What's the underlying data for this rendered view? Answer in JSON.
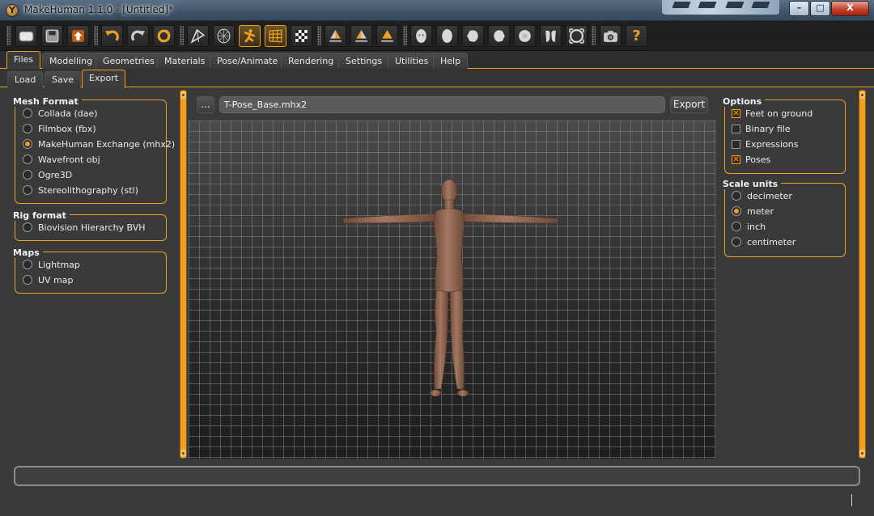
{
  "window": {
    "title": "MakeHuman 1.1.0 - [Untitled]*",
    "controls": {
      "minimize": "–",
      "maximize": "□",
      "close": "X"
    }
  },
  "toolbar": {
    "tools": [
      "undo-icon",
      "redo-icon",
      "reset-icon",
      "smooth-icon",
      "wireframe-icon",
      "pose-icon",
      "grid-icon",
      "checker-icon",
      "symmetry-right-icon",
      "symmetry-left-icon",
      "symmetry-icon",
      "front-view-icon",
      "back-view-icon",
      "left-view-icon",
      "right-view-icon",
      "top-view-icon",
      "bottom-view-icon",
      "reset-camera-icon",
      "screenshot-icon",
      "help-icon"
    ],
    "help_label": "?"
  },
  "tabs": [
    {
      "label": "Files",
      "active": true
    },
    {
      "label": "Modelling"
    },
    {
      "label": "Geometries"
    },
    {
      "label": "Materials"
    },
    {
      "label": "Pose/Animate"
    },
    {
      "label": "Rendering"
    },
    {
      "label": "Settings"
    },
    {
      "label": "Utilities"
    },
    {
      "label": "Help"
    }
  ],
  "subtabs": [
    {
      "label": "Load"
    },
    {
      "label": "Save"
    },
    {
      "label": "Export",
      "active": true
    }
  ],
  "left": {
    "mesh_format": {
      "title": "Mesh Format",
      "options": [
        {
          "label": "Collada (dae)",
          "selected": false
        },
        {
          "label": "Filmbox (fbx)",
          "selected": false
        },
        {
          "label": "MakeHuman Exchange (mhx2)",
          "selected": true
        },
        {
          "label": "Wavefront obj",
          "selected": false
        },
        {
          "label": "Ogre3D",
          "selected": false
        },
        {
          "label": "Stereolithography (stl)",
          "selected": false
        }
      ]
    },
    "rig_format": {
      "title": "Rig format",
      "options": [
        {
          "label": "Biovision Hierarchy BVH",
          "selected": false
        }
      ]
    },
    "maps": {
      "title": "Maps",
      "options": [
        {
          "label": "Lightmap",
          "selected": false
        },
        {
          "label": "UV map",
          "selected": false
        }
      ]
    }
  },
  "export_row": {
    "browse_label": "...",
    "filename": "T-Pose_Base.mhx2",
    "export_label": "Export"
  },
  "right": {
    "options": {
      "title": "Options",
      "items": [
        {
          "label": "Feet on ground",
          "checked": true
        },
        {
          "label": "Binary file",
          "checked": false
        },
        {
          "label": "Expressions",
          "checked": false
        },
        {
          "label": "Poses",
          "checked": true
        }
      ]
    },
    "scale_units": {
      "title": "Scale units",
      "options": [
        {
          "label": "decimeter",
          "selected": false
        },
        {
          "label": "meter",
          "selected": true
        },
        {
          "label": "inch",
          "selected": false
        },
        {
          "label": "centimeter",
          "selected": false
        }
      ]
    }
  },
  "colors": {
    "accent": "#f0a020",
    "background": "#3a3a3a",
    "skin": "#9c7058"
  }
}
